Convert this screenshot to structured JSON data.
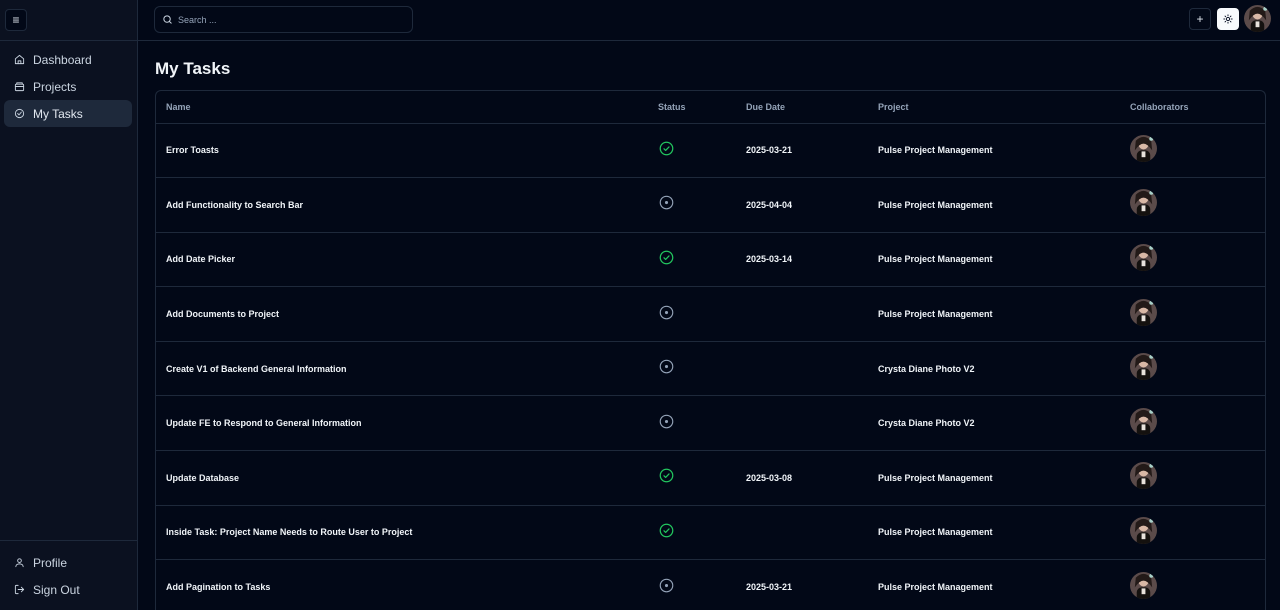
{
  "sidebar": {
    "toggle_icon": "menu-icon",
    "nav": [
      {
        "label": "Dashboard",
        "icon": "home-icon",
        "active": false
      },
      {
        "label": "Projects",
        "icon": "folders-icon",
        "active": false
      },
      {
        "label": "My Tasks",
        "icon": "check-circle-icon",
        "active": true
      }
    ],
    "bottom": [
      {
        "label": "Profile",
        "icon": "user-icon"
      },
      {
        "label": "Sign Out",
        "icon": "logout-icon"
      }
    ]
  },
  "header": {
    "search_placeholder": "Search ...",
    "add_label": "+",
    "theme_icon": "sun-icon"
  },
  "page": {
    "title": "My Tasks"
  },
  "table": {
    "columns": [
      "Name",
      "Status",
      "Due Date",
      "Project",
      "Collaborators"
    ],
    "rows": [
      {
        "name": "Error Toasts",
        "status": "done",
        "due": "2025-03-21",
        "project": "Pulse Project Management"
      },
      {
        "name": "Add Functionality to Search Bar",
        "status": "open",
        "due": "2025-04-04",
        "project": "Pulse Project Management"
      },
      {
        "name": "Add Date Picker",
        "status": "done",
        "due": "2025-03-14",
        "project": "Pulse Project Management"
      },
      {
        "name": "Add Documents to Project",
        "status": "open",
        "due": "",
        "project": "Pulse Project Management"
      },
      {
        "name": "Create V1 of Backend General Information",
        "status": "open",
        "due": "",
        "project": "Crysta Diane Photo V2"
      },
      {
        "name": "Update FE to Respond to General Information",
        "status": "open",
        "due": "",
        "project": "Crysta Diane Photo V2"
      },
      {
        "name": "Update Database",
        "status": "done",
        "due": "2025-03-08",
        "project": "Pulse Project Management"
      },
      {
        "name": "Inside Task: Project Name Needs to Route User to Project",
        "status": "done",
        "due": "",
        "project": "Pulse Project Management"
      },
      {
        "name": "Add Pagination to Tasks",
        "status": "open",
        "due": "2025-03-21",
        "project": "Pulse Project Management"
      }
    ]
  },
  "colors": {
    "background": "#020817",
    "sidebar": "#0b1120",
    "border": "#1e293b",
    "done_status": "#22c55e",
    "open_status": "#94a3b8"
  }
}
